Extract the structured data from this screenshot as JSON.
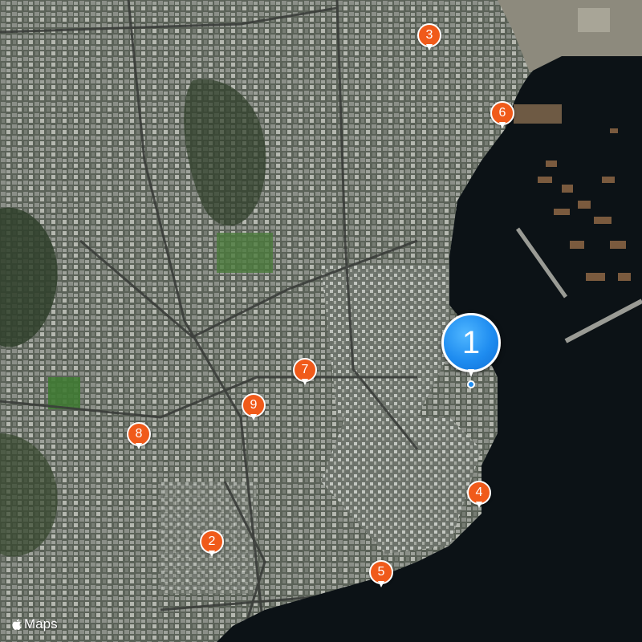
{
  "map": {
    "type": "satellite",
    "colors": {
      "land": "#5b6258",
      "water": "#0c1216",
      "vegetation": "#2f3f2a",
      "pin": "#f05a1a",
      "pin_main": "#1e8cf0"
    }
  },
  "pins": [
    {
      "label": "3"
    },
    {
      "label": "6"
    },
    {
      "label": "7"
    },
    {
      "label": "9"
    },
    {
      "label": "8"
    },
    {
      "label": "4"
    },
    {
      "label": "2"
    },
    {
      "label": "5"
    }
  ],
  "selected_pin": {
    "label": "1"
  },
  "branding": {
    "label": "Maps",
    "icon": "apple-logo-icon"
  }
}
